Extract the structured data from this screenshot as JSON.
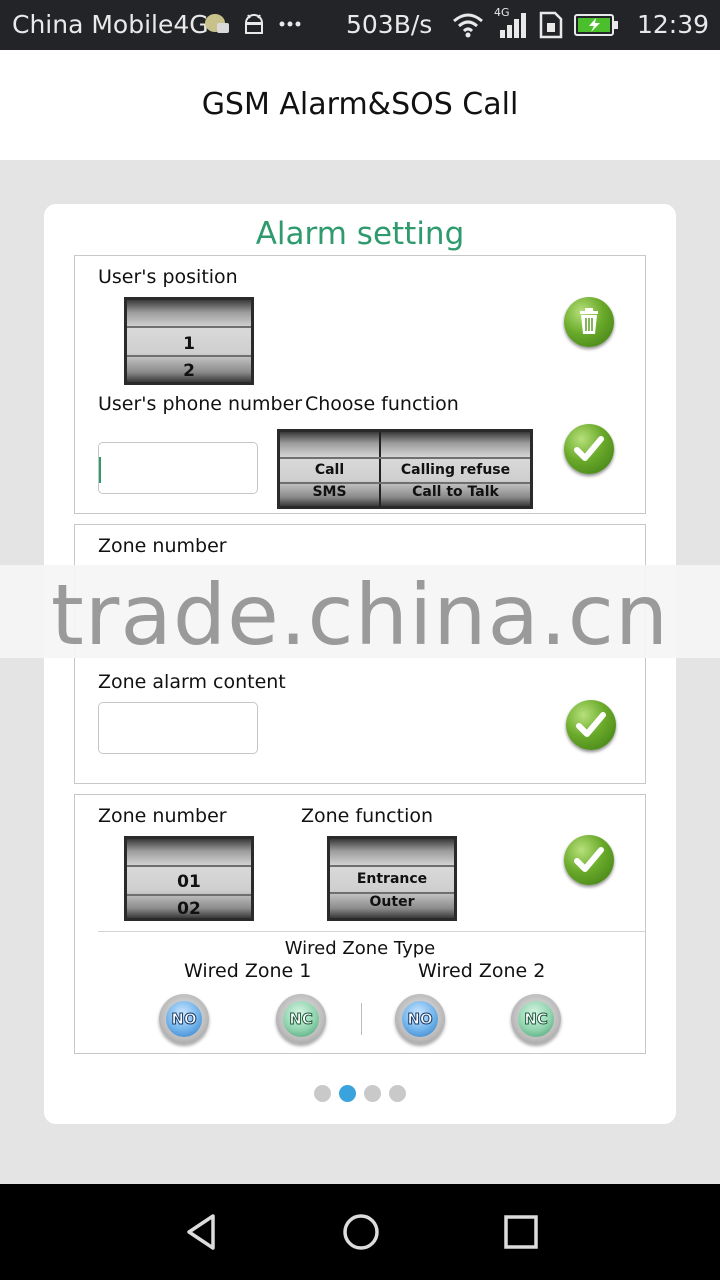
{
  "status_bar": {
    "carrier": "China Mobile4G",
    "net_speed": "503B/s",
    "network_label": "4G",
    "time": "12:39",
    "icons": [
      "chat-notification-icon",
      "android-icon",
      "more-dots-icon",
      "wifi-icon",
      "signal-icon",
      "sim-card-icon",
      "battery-charging-icon"
    ]
  },
  "app": {
    "title": "GSM Alarm&SOS Call"
  },
  "card": {
    "title": "Alarm setting",
    "title_color": "#2e9a6e"
  },
  "user_panel": {
    "position_label": "User's position",
    "position_values": [
      "1",
      "2"
    ],
    "phone_label": "User's phone number",
    "phone_value": "",
    "function_label": "Choose function",
    "function_left": [
      "Call",
      "SMS"
    ],
    "function_right": [
      "Calling refuse",
      "Call to Talk"
    ]
  },
  "zone_alarm_panel": {
    "zone_label": "Zone number",
    "content_label": "Zone alarm content",
    "content_value": ""
  },
  "zone_function_panel": {
    "zone_label": "Zone number",
    "zone_values": [
      "01",
      "02"
    ],
    "function_label": "Zone function",
    "function_values": [
      "Entrance",
      "Outer"
    ],
    "wired_type_label": "Wired Zone Type",
    "wired_zone1_label": "Wired Zone 1",
    "wired_zone2_label": "Wired Zone 2",
    "zone1_options": [
      "NO",
      "NC"
    ],
    "zone2_options": [
      "NO",
      "NC"
    ]
  },
  "watermark": "trade.china.cn",
  "pager": {
    "pages": 4,
    "active": 2,
    "active_color": "#3aa3dd"
  },
  "nav": {
    "back_icon": "back-triangle-icon",
    "home_icon": "home-circle-icon",
    "recents_icon": "recents-square-icon"
  }
}
